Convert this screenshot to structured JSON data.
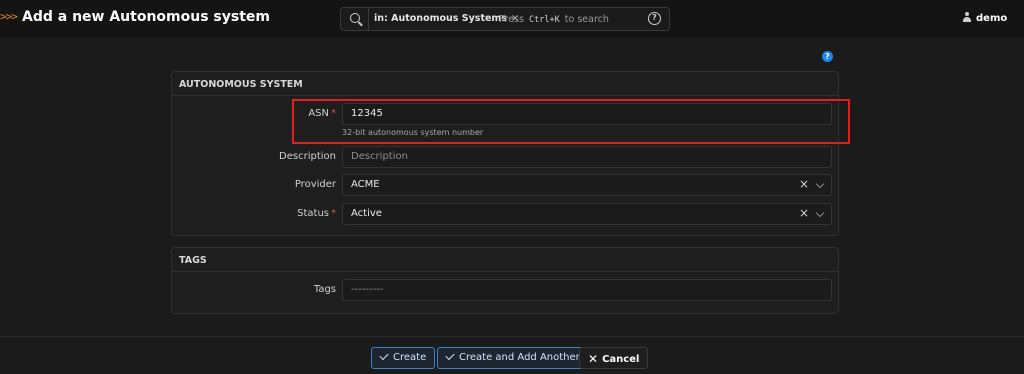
{
  "header": {
    "brand_icon": ">>>",
    "title": "Add a new Autonomous system",
    "search": {
      "chip_label": "in: Autonomous Systems",
      "chip_close": "×",
      "hint_prefix": "Press",
      "hint_key": "Ctrl+K",
      "hint_suffix": "to search",
      "help": "?"
    },
    "user": "demo"
  },
  "help_bubble": "?",
  "as_card": {
    "title": "AUTONOMOUS SYSTEM",
    "asn": {
      "label": "ASN",
      "required": "*",
      "value": "12345",
      "help": "32-bit autonomous system number"
    },
    "description": {
      "label": "Description",
      "placeholder": "Description"
    },
    "provider": {
      "label": "Provider",
      "value": "ACME",
      "clear": "×"
    },
    "status": {
      "label": "Status",
      "required": "*",
      "value": "Active",
      "clear": "×"
    }
  },
  "tags_card": {
    "title": "TAGS",
    "tags": {
      "label": "Tags",
      "placeholder": "---------"
    }
  },
  "buttons": {
    "create": "Create",
    "create_another": "Create and Add Another",
    "cancel": "Cancel",
    "cancel_icon": "✕"
  },
  "colors": {
    "background": "#1b1b1b",
    "accent": "#3b82c4",
    "required": "#e05252",
    "highlight": "#e02020"
  }
}
